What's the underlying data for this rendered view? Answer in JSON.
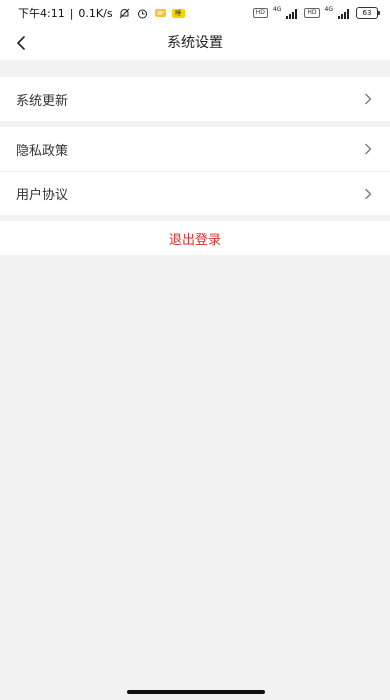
{
  "status_bar": {
    "time": "下午4:11",
    "net_speed": "0.1K/s",
    "separator": "|",
    "app_badge": "睡",
    "hd_1": "HD",
    "net_1": "4G",
    "hd_2": "HD",
    "net_2": "4G",
    "battery": "63"
  },
  "header": {
    "title": "系统设置"
  },
  "settings": {
    "update_label": "系统更新",
    "privacy_label": "隐私政策",
    "agreement_label": "用户协议",
    "logout_label": "退出登录"
  },
  "colors": {
    "background": "#f2f2f2",
    "surface": "#ffffff",
    "logout_text": "#d93030",
    "divider": "#eeeeee"
  },
  "icons": {
    "back": "chevron-left-icon",
    "row_arrow": "chevron-right-icon"
  }
}
